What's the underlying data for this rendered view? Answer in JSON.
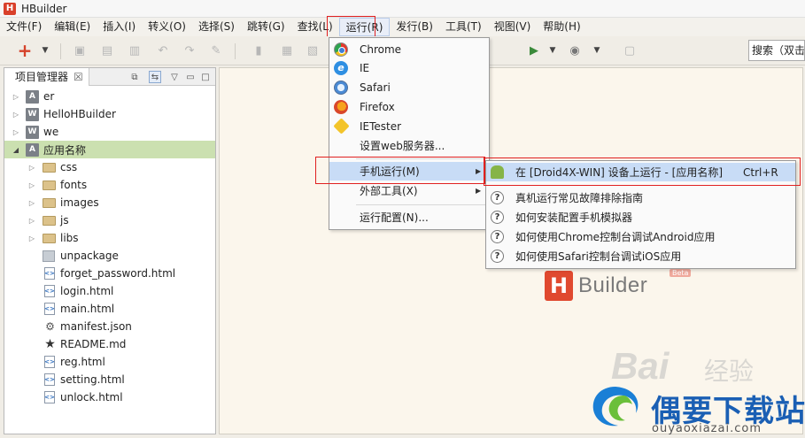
{
  "window": {
    "title": "HBuilder",
    "logo_letter": "H"
  },
  "menubar": {
    "items": [
      "文件(F)",
      "编辑(E)",
      "插入(I)",
      "转义(O)",
      "选择(S)",
      "跳转(G)",
      "查找(L)",
      "运行(R)",
      "发行(B)",
      "工具(T)",
      "视图(V)",
      "帮助(H)"
    ],
    "active": "运行(R)"
  },
  "toolbar": {
    "search_placeholder": "搜索（双击"
  },
  "project_panel": {
    "tab_label": "项目管理器",
    "tab_close": "☒",
    "tree": [
      {
        "label": "er",
        "type": "project",
        "badge": "A",
        "expanded": false
      },
      {
        "label": "HelloHBuilder",
        "type": "project",
        "badge": "W",
        "expanded": false
      },
      {
        "label": "we",
        "type": "project",
        "badge": "W",
        "expanded": false
      },
      {
        "label": "应用名称",
        "type": "project",
        "badge": "A",
        "expanded": true,
        "selected": true
      },
      {
        "label": "css",
        "type": "folder",
        "expanded": false
      },
      {
        "label": "fonts",
        "type": "folder",
        "expanded": false
      },
      {
        "label": "images",
        "type": "folder",
        "expanded": false
      },
      {
        "label": "js",
        "type": "folder",
        "expanded": false
      },
      {
        "label": "libs",
        "type": "folder",
        "expanded": false
      },
      {
        "label": "unpackage",
        "type": "package"
      },
      {
        "label": "forget_password.html",
        "type": "file"
      },
      {
        "label": "login.html",
        "type": "file"
      },
      {
        "label": "main.html",
        "type": "file"
      },
      {
        "label": "manifest.json",
        "type": "json"
      },
      {
        "label": "README.md",
        "type": "markdown"
      },
      {
        "label": "reg.html",
        "type": "file"
      },
      {
        "label": "setting.html",
        "type": "file"
      },
      {
        "label": "unlock.html",
        "type": "file"
      }
    ]
  },
  "run_menu": {
    "items": [
      {
        "label": "Chrome",
        "icon": "chrome-icon"
      },
      {
        "label": "IE",
        "icon": "ie-icon"
      },
      {
        "label": "Safari",
        "icon": "safari-icon"
      },
      {
        "label": "Firefox",
        "icon": "firefox-icon"
      },
      {
        "label": "IETester",
        "icon": "ietester-icon"
      },
      {
        "label": "设置web服务器...",
        "icon": ""
      },
      {
        "label": "手机运行(M)",
        "icon": "",
        "submenu": true,
        "hover": true
      },
      {
        "label": "外部工具(X)",
        "icon": "",
        "submenu": true
      },
      {
        "label": "运行配置(N)...",
        "icon": ""
      }
    ]
  },
  "mobile_submenu": {
    "items": [
      {
        "label": "在 [Droid4X-WIN] 设备上运行 - [应用名称]",
        "shortcut": "Ctrl+R",
        "icon": "android-icon",
        "hover": true
      },
      {
        "label": "真机运行常见故障排除指南",
        "icon": "help-icon"
      },
      {
        "label": "如何安装配置手机模拟器",
        "icon": "help-icon"
      },
      {
        "label": "如何使用Chrome控制台调试Android应用",
        "icon": "help-icon"
      },
      {
        "label": "如何使用Safari控制台调试iOS应用",
        "icon": "help-icon"
      }
    ]
  },
  "editor": {
    "logo_letter": "H",
    "logo_word": "Builder",
    "logo_badge": "Beta"
  },
  "watermark": {
    "baidu": "Bai",
    "baidu_cn": "经验",
    "site_name": "偶要下载站",
    "site_url": "ouyaoxiazai.com"
  }
}
